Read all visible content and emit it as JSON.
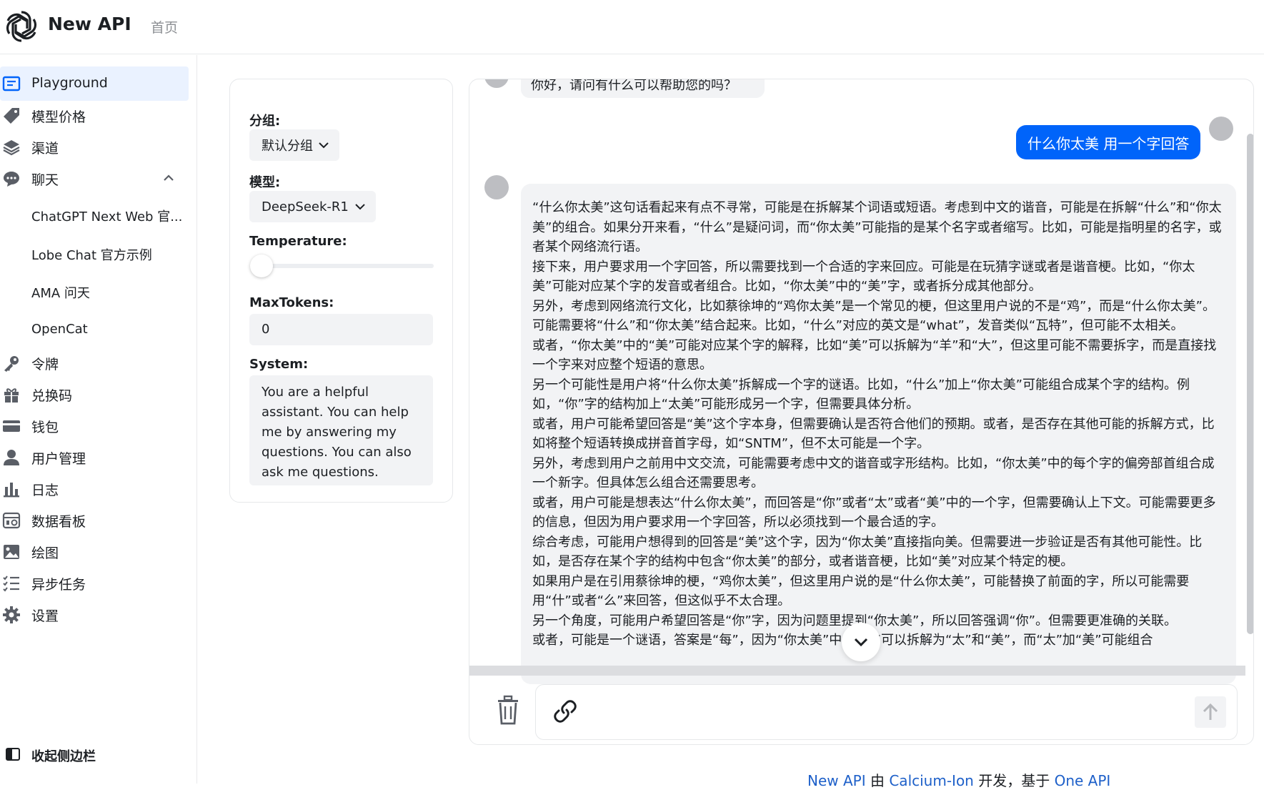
{
  "header": {
    "app_name": "New API",
    "nav_home": "首页"
  },
  "sidebar": {
    "items": [
      {
        "label": "Playground",
        "icon": "message-square-icon",
        "active": true
      },
      {
        "label": "模型价格",
        "icon": "price-tag-icon"
      },
      {
        "label": "渠道",
        "icon": "layers-icon"
      },
      {
        "label": "聊天",
        "icon": "chat-bubble-icon"
      },
      {
        "label": "ChatGPT Next Web 官...",
        "sub": true
      },
      {
        "label": "Lobe Chat 官方示例",
        "sub": true
      },
      {
        "label": "AMA 问天",
        "sub": true
      },
      {
        "label": "OpenCat",
        "sub": true
      },
      {
        "label": "令牌",
        "icon": "key-icon"
      },
      {
        "label": "兑换码",
        "icon": "gift-icon"
      },
      {
        "label": "钱包",
        "icon": "credit-card-icon"
      },
      {
        "label": "用户管理",
        "icon": "user-icon"
      },
      {
        "label": "日志",
        "icon": "bar-chart-icon"
      },
      {
        "label": "数据看板",
        "icon": "dashboard-icon"
      },
      {
        "label": "绘图",
        "icon": "image-icon"
      },
      {
        "label": "异步任务",
        "icon": "task-list-icon"
      },
      {
        "label": "设置",
        "icon": "gear-icon"
      }
    ],
    "collapse_label": "收起侧边栏"
  },
  "settings": {
    "group_label": "分组:",
    "group_value": "默认分组",
    "model_label": "模型:",
    "model_value": "DeepSeek-R1",
    "temperature_label": "Temperature:",
    "temperature_level": 0,
    "max_tokens_label": "MaxTokens:",
    "max_tokens_value": "0",
    "system_label": "System:",
    "system_value": "You are a helpful assistant. You can help me by answering my questions. You can also ask me questions."
  },
  "chat": {
    "first_message": "你好，请问有什么可以帮助您的吗？",
    "user_message": "什么你太美 用一个字回答",
    "assistant_paragraphs": [
      "“什么你太美”这句话看起来有点不寻常，可能是在拆解某个词语或短语。考虑到中文的谐音，可能是在拆解“什么”和“你太美”的组合。如果分开来看，“什么”是疑问词，而“你太美”可能指的是某个名字或者缩写。比如，可能是指明星的名字，或者某个网络流行语。",
      "接下来，用户要求用一个字回答，所以需要找到一个合适的字来回应。可能是在玩猜字谜或者是谐音梗。比如，“你太美”可能对应某个字的发音或者组合。比如，“你太美”中的“美”字，或者拆分成其他部分。",
      "另外，考虑到网络流行文化，比如蔡徐坤的“鸡你太美”是一个常见的梗，但这里用户说的不是“鸡”，而是“什么你太美”。可能需要将“什么”和“你太美”结合起来。比如，“什么”对应的英文是“what”，发音类似“瓦特”，但可能不太相关。",
      "或者，“你太美”中的“美”可能对应某个字的解释，比如“美”可以拆解为“羊”和“大”，但这里可能不需要拆字，而是直接找一个字来对应整个短语的意思。",
      "另一个可能性是用户将“什么你太美”拆解成一个字的谜语。比如，“什么”加上“你太美”可能组合成某个字的结构。例如，“你”字的结构加上“太美”可能形成另一个字，但需要具体分析。",
      "或者，用户可能希望回答是“美”这个字本身，但需要确认是否符合他们的预期。或者，是否存在其他可能的拆解方式，比如将整个短语转换成拼音首字母，如“SNTM”，但不太可能是一个字。",
      "另外，考虑到用户之前用中文交流，可能需要考虑中文的谐音或字形结构。比如，“你太美”中的每个字的偏旁部首组合成一个新字。但具体怎么组合还需要思考。",
      "或者，用户可能是想表达“什么你太美”，而回答是“你”或者“太”或者“美”中的一个字，但需要确认上下文。可能需要更多的信息，但因为用户要求用一个字回答，所以必须找到一个最合适的字。",
      "综合考虑，可能用户想得到的回答是“美”这个字，因为“你太美”直接指向美。但需要进一步验证是否有其他可能性。比如，是否存在某个字的结构中包含“你太美”的部分，或者谐音梗，比如“美”对应某个特定的梗。",
      "如果用户是在引用蔡徐坤的梗，“鸡你太美”，但这里用户说的是“什么你太美”，可能替换了前面的字，所以可能需要用“什”或者“么”来回答，但这似乎不太合理。",
      "另一个角度，可能用户希望回答是“你”字，因为问题里提到“你太美”，所以回答强调“你”。但需要更准确的关联。",
      "或者，可能是一个谜语，答案是“每”，因为“你太美”中“太美”可以拆解为“太”和“美”，而“太”加“美”可能组合"
    ]
  },
  "footer": {
    "part1": "New API",
    "part2": " 由 ",
    "part3": "Calcium-Ion",
    "part4": " 开发，基于 ",
    "part5": "One API"
  },
  "colors": {
    "accent": "#0064fa",
    "active_bg": "#eaf2ff",
    "bubble_bg": "#f2f3f5",
    "link": "#1e60c9"
  }
}
